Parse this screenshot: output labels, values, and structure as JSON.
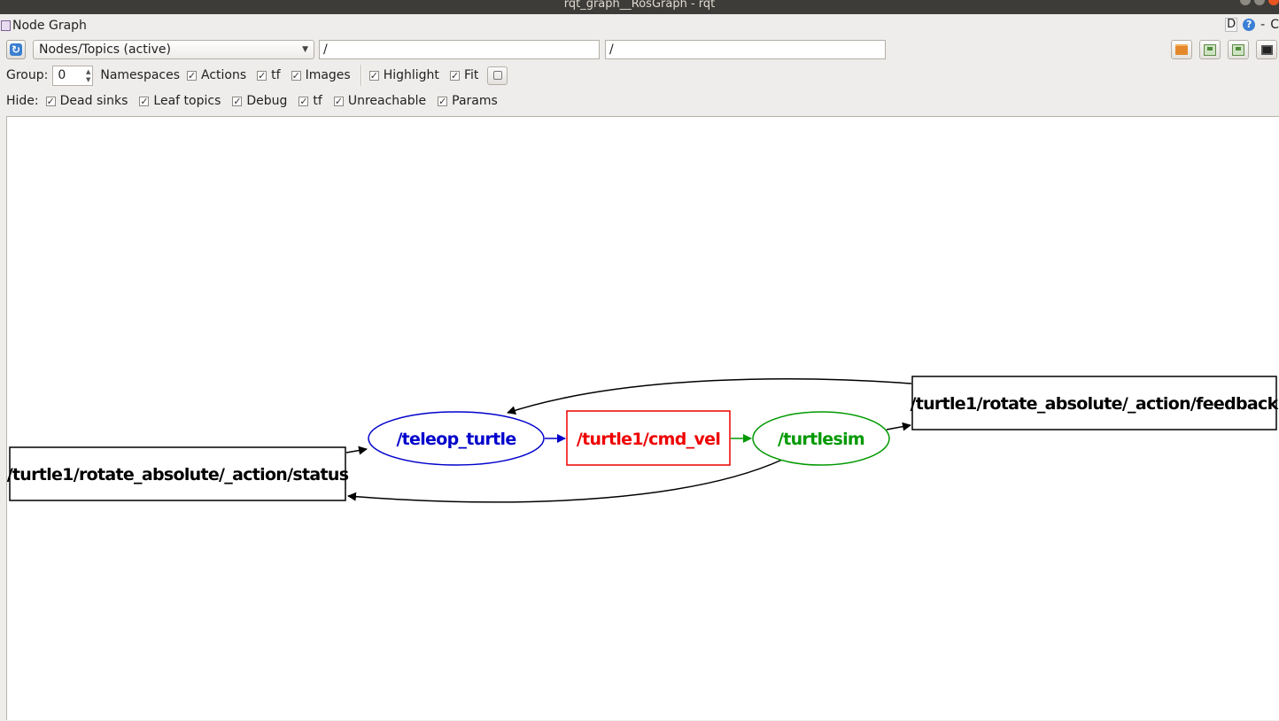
{
  "window": {
    "title": "rqt_graph__RosGraph - rqt"
  },
  "plugin": {
    "title": "Node Graph",
    "d_label": "D",
    "help_label": "?",
    "minimize_label": "-"
  },
  "toolbar": {
    "refresh_icon": "refresh-icon",
    "view_mode": "Nodes/Topics (active)",
    "node_filter": "/",
    "topic_filter": "/",
    "buttons": [
      "load-dot-icon",
      "save-dot-icon",
      "save-svg-icon",
      "save-image-icon"
    ]
  },
  "options": {
    "group_label": "Group:",
    "group_value": "0",
    "namespaces_label": "Namespaces",
    "actions_label": "Actions",
    "tf_label": "tf",
    "images_label": "Images",
    "highlight_label": "Highlight",
    "fit_label": "Fit",
    "namespaces_checked": true,
    "actions_checked": true,
    "tf_checked": true,
    "images_checked": true,
    "highlight_checked": true,
    "fit_checked": true
  },
  "hide": {
    "label": "Hide:",
    "dead_sinks": "Dead sinks",
    "leaf_topics": "Leaf topics",
    "debug": "Debug",
    "tf": "tf",
    "unreachable": "Unreachable",
    "params": "Params",
    "all_checked": true
  },
  "graph": {
    "nodes": {
      "status": {
        "label": "/turtle1/rotate_absolute/_action/status",
        "shape": "box",
        "color": "#000000"
      },
      "teleop": {
        "label": "/teleop_turtle",
        "shape": "ellipse",
        "color": "#0000cc"
      },
      "cmd_vel": {
        "label": "/turtle1/cmd_vel",
        "shape": "box",
        "color": "#ee0000"
      },
      "turtlesim": {
        "label": "/turtlesim",
        "shape": "ellipse",
        "color": "#009900"
      },
      "feedback": {
        "label": "/turtle1/rotate_absolute/_action/feedback",
        "shape": "box",
        "color": "#000000"
      }
    },
    "edges": [
      {
        "from": "status",
        "to": "teleop",
        "color": "#000000"
      },
      {
        "from": "teleop",
        "to": "cmd_vel",
        "color": "#0000cc"
      },
      {
        "from": "cmd_vel",
        "to": "turtlesim",
        "color": "#009900"
      },
      {
        "from": "turtlesim",
        "to": "feedback",
        "color": "#000000"
      },
      {
        "from": "feedback",
        "to": "teleop",
        "color": "#000000"
      },
      {
        "from": "turtlesim",
        "to": "status",
        "color": "#000000"
      }
    ]
  }
}
